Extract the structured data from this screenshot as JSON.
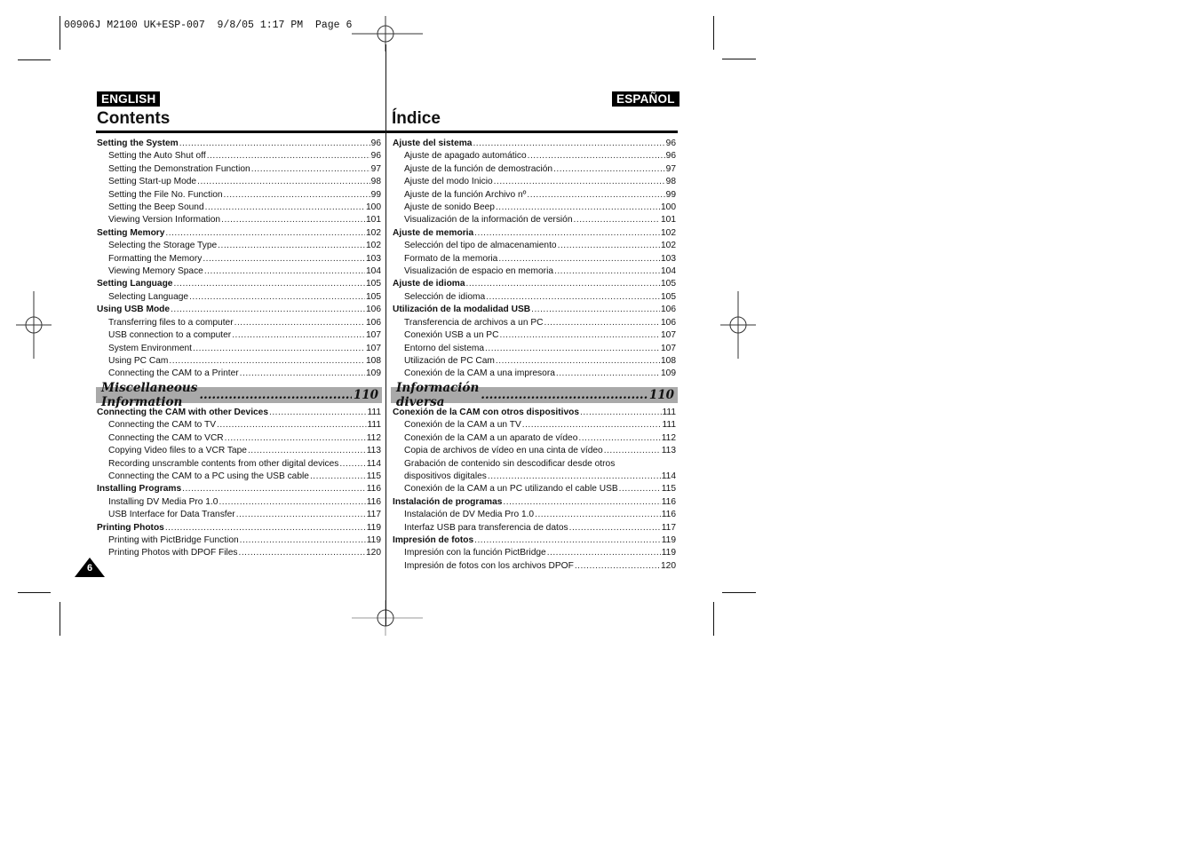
{
  "slug": "00906J M2100 UK+ESP-007  9/8/05 1:17 PM  Page 6",
  "page_number": "6",
  "english": {
    "badge": "ENGLISH",
    "title": "Contents",
    "section1": [
      {
        "level": 1,
        "text": "Setting the System",
        "page": "96"
      },
      {
        "level": 2,
        "text": "Setting the Auto Shut off",
        "page": "96"
      },
      {
        "level": 2,
        "text": "Setting the Demonstration Function",
        "page": "97"
      },
      {
        "level": 2,
        "text": "Setting Start-up Mode",
        "page": "98"
      },
      {
        "level": 2,
        "text": "Setting the File No. Function",
        "page": "99"
      },
      {
        "level": 2,
        "text": "Setting the Beep Sound",
        "page": "100"
      },
      {
        "level": 2,
        "text": "Viewing Version Information",
        "page": "101"
      },
      {
        "level": 1,
        "text": "Setting Memory",
        "page": "102"
      },
      {
        "level": 2,
        "text": "Selecting the Storage Type",
        "page": "102"
      },
      {
        "level": 2,
        "text": "Formatting the Memory",
        "page": "103"
      },
      {
        "level": 2,
        "text": "Viewing Memory Space",
        "page": "104"
      },
      {
        "level": 1,
        "text": "Setting Language",
        "page": "105"
      },
      {
        "level": 2,
        "text": "Selecting Language",
        "page": "105"
      },
      {
        "level": 1,
        "text": "Using USB Mode",
        "page": "106"
      },
      {
        "level": 2,
        "text": "Transferring files to a computer",
        "page": "106"
      },
      {
        "level": 2,
        "text": "USB connection to a computer",
        "page": "107"
      },
      {
        "level": 2,
        "text": "System Environment",
        "page": "107"
      },
      {
        "level": 2,
        "text": "Using PC Cam",
        "page": "108"
      },
      {
        "level": 2,
        "text": "Connecting the CAM to a Printer",
        "page": "109"
      }
    ],
    "misc_heading": {
      "text": "Miscellaneous Information",
      "page": "110"
    },
    "section2": [
      {
        "level": 1,
        "text": "Connecting the CAM with other Devices",
        "page": "111"
      },
      {
        "level": 2,
        "text": "Connecting the CAM to TV",
        "page": "111"
      },
      {
        "level": 2,
        "text": "Connecting the CAM to VCR",
        "page": "112"
      },
      {
        "level": 2,
        "text": "Copying Video files to a VCR Tape",
        "page": "113"
      },
      {
        "level": 2,
        "text": "Recording unscramble contents from other digital devices",
        "page": "114"
      },
      {
        "level": 2,
        "text": "Connecting the CAM to a PC using the USB cable",
        "page": "115"
      },
      {
        "level": 1,
        "text": "Installing Programs",
        "page": "116"
      },
      {
        "level": 2,
        "text": "Installing DV Media Pro 1.0",
        "page": "116"
      },
      {
        "level": 2,
        "text": "USB Interface for Data Transfer",
        "page": "117"
      },
      {
        "level": 1,
        "text": "Printing Photos",
        "page": "119"
      },
      {
        "level": 2,
        "text": "Printing with PictBridge Function",
        "page": "119"
      },
      {
        "level": 2,
        "text": "Printing Photos with DPOF Files",
        "page": "120"
      }
    ]
  },
  "spanish": {
    "badge": "ESPAÑOL",
    "title": "Índice",
    "section1": [
      {
        "level": 1,
        "text": "Ajuste del sistema",
        "page": "96"
      },
      {
        "level": 2,
        "text": "Ajuste de apagado automático",
        "page": "96"
      },
      {
        "level": 2,
        "text": "Ajuste de la función de demostración",
        "page": "97"
      },
      {
        "level": 2,
        "text": "Ajuste del modo Inicio",
        "page": "98"
      },
      {
        "level": 2,
        "text": "Ajuste de la función Archivo nº",
        "page": "99"
      },
      {
        "level": 2,
        "text": "Ajuste de sonido Beep",
        "page": "100"
      },
      {
        "level": 2,
        "text": "Visualización de la información de versión",
        "page": "101"
      },
      {
        "level": 1,
        "text": "Ajuste de memoria",
        "page": "102"
      },
      {
        "level": 2,
        "text": "Selección del tipo de almacenamiento",
        "page": "102"
      },
      {
        "level": 2,
        "text": "Formato de la memoria",
        "page": "103"
      },
      {
        "level": 2,
        "text": "Visualización de espacio en memoria",
        "page": "104"
      },
      {
        "level": 1,
        "text": "Ajuste de idioma",
        "page": "105"
      },
      {
        "level": 2,
        "text": "Selección de idioma",
        "page": "105"
      },
      {
        "level": 1,
        "text": "Utilización de la modalidad USB",
        "page": "106"
      },
      {
        "level": 2,
        "text": "Transferencia de archivos a un PC",
        "page": "106"
      },
      {
        "level": 2,
        "text": "Conexión USB a un PC",
        "page": "107"
      },
      {
        "level": 2,
        "text": "Entorno del sistema",
        "page": "107"
      },
      {
        "level": 2,
        "text": "Utilización de PC Cam",
        "page": "108"
      },
      {
        "level": 2,
        "text": "Conexión de la CAM a una impresora",
        "page": "109"
      }
    ],
    "misc_heading": {
      "text": "Información diversa",
      "page": "110"
    },
    "section2": [
      {
        "level": 1,
        "text": "Conexión de la CAM con otros dispositivos",
        "page": "111"
      },
      {
        "level": 2,
        "text": "Conexión de la CAM a un TV",
        "page": "111"
      },
      {
        "level": 2,
        "text": "Conexión de la CAM a un aparato de vídeo",
        "page": "112"
      },
      {
        "level": 2,
        "text": "Copia de archivos de vídeo en una cinta de vídeo",
        "page": "113"
      },
      {
        "level": 3,
        "text": "Grabación de contenido sin descodificar desde otros",
        "page": ""
      },
      {
        "level": 2,
        "text": "dispositivos digitales",
        "page": "114"
      },
      {
        "level": 2,
        "text": "Conexión de la CAM a un PC utilizando el cable USB",
        "page": "115"
      },
      {
        "level": 1,
        "text": "Instalación de programas",
        "page": "116"
      },
      {
        "level": 2,
        "text": "Instalación de DV Media Pro 1.0",
        "page": "116"
      },
      {
        "level": 2,
        "text": "Interfaz USB para transferencia de datos",
        "page": "117"
      },
      {
        "level": 1,
        "text": "Impresión de fotos",
        "page": "119"
      },
      {
        "level": 2,
        "text": "Impresión con la función PictBridge",
        "page": "119"
      },
      {
        "level": 2,
        "text": "Impresión de fotos con los archivos DPOF",
        "page": "120"
      }
    ]
  }
}
